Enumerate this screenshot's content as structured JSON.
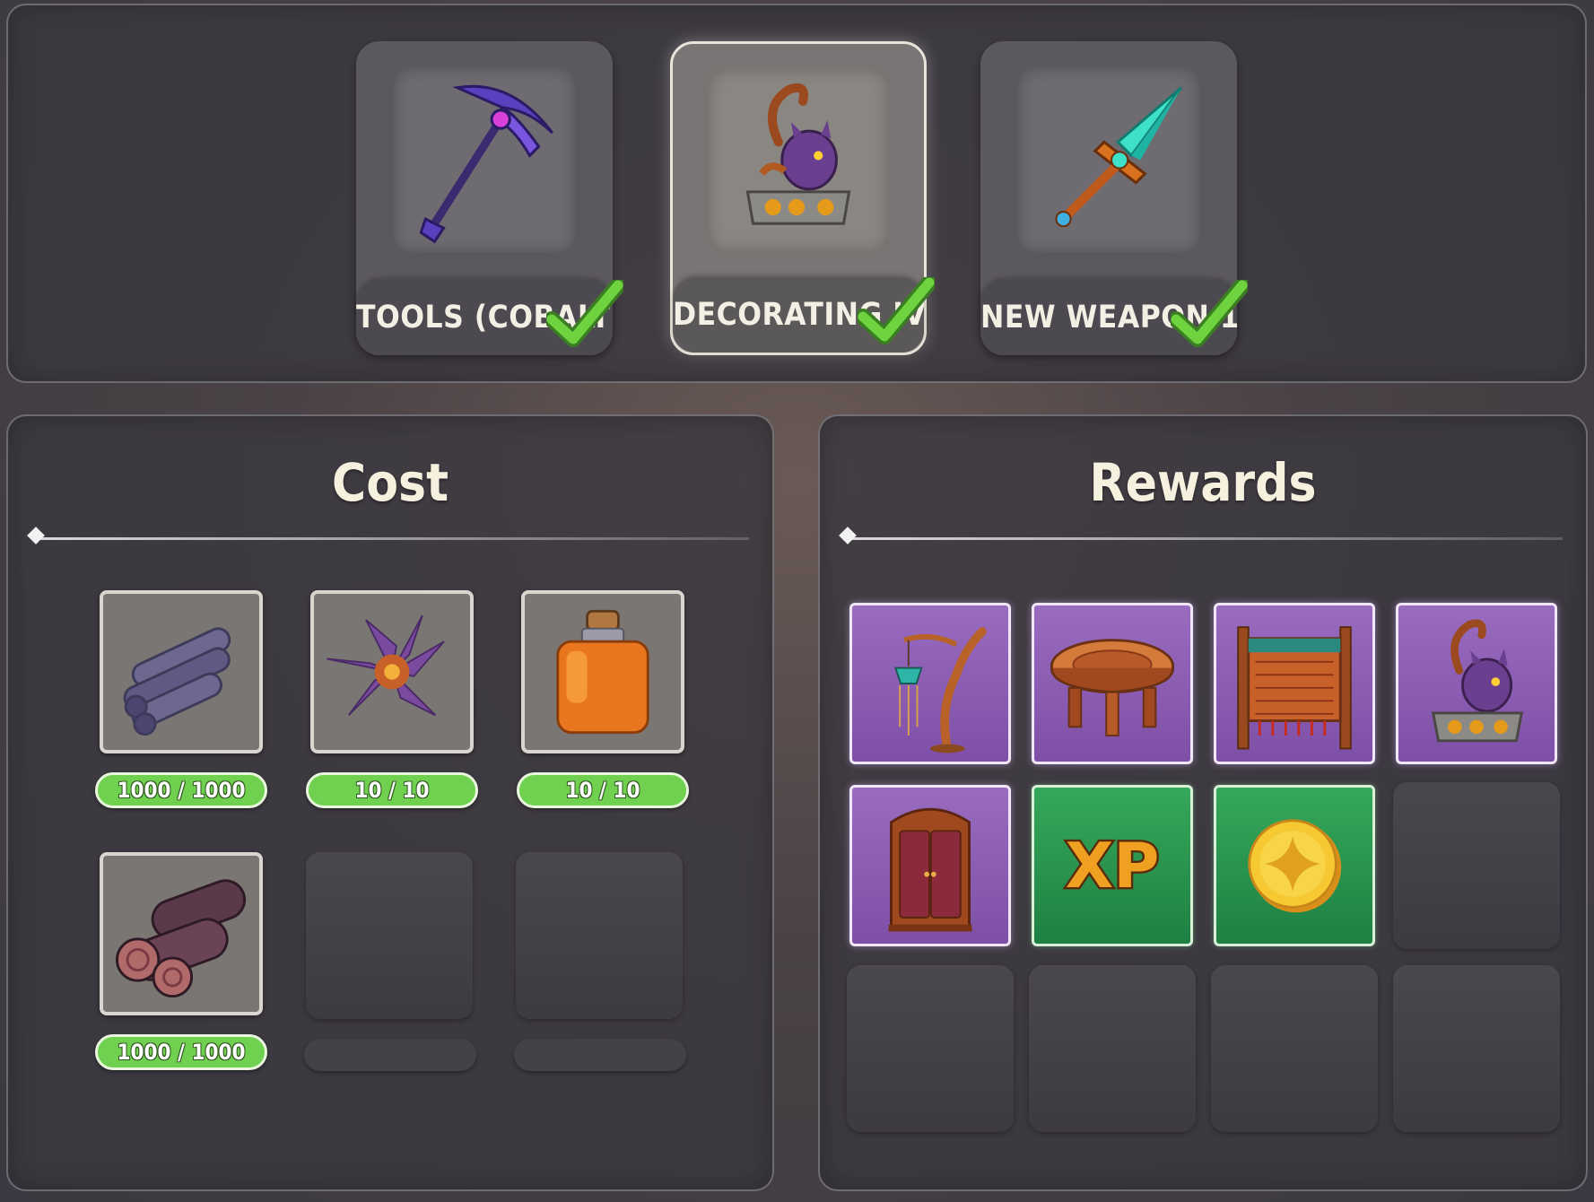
{
  "quests": [
    {
      "label": "TOOLS (COBALT)",
      "icon": "cobalt-pickaxe-icon",
      "completed": true,
      "selected": false
    },
    {
      "label": "DECORATING IV",
      "icon": "scorpion-statue-icon",
      "completed": true,
      "selected": true
    },
    {
      "label": "NEW WEAPON 1",
      "icon": "crystal-sword-icon",
      "completed": true,
      "selected": false
    }
  ],
  "cost": {
    "title": "Cost",
    "items": [
      {
        "icon": "bamboo-logs-icon",
        "progress": "1000 / 1000"
      },
      {
        "icon": "purple-flower-icon",
        "progress": "10 / 10"
      },
      {
        "icon": "orange-potion-icon",
        "progress": "10 / 10"
      },
      {
        "icon": "wood-logs-icon",
        "progress": "1000 / 1000"
      }
    ]
  },
  "rewards": {
    "title": "Rewards",
    "items": [
      {
        "icon": "hanging-lantern-icon",
        "rarity": "purple"
      },
      {
        "icon": "round-table-icon",
        "rarity": "purple"
      },
      {
        "icon": "tapestry-frame-icon",
        "rarity": "purple"
      },
      {
        "icon": "scorpion-statue-icon",
        "rarity": "purple"
      },
      {
        "icon": "wardrobe-icon",
        "rarity": "purple"
      },
      {
        "icon": "xp-icon",
        "rarity": "green",
        "text": "XP"
      },
      {
        "icon": "gold-coin-icon",
        "rarity": "green"
      }
    ]
  },
  "colors": {
    "progress_fill": "#6fd14f",
    "reward_purple": "#8a5cb3",
    "reward_green": "#2a9650",
    "check_green": "#6ed33f"
  }
}
